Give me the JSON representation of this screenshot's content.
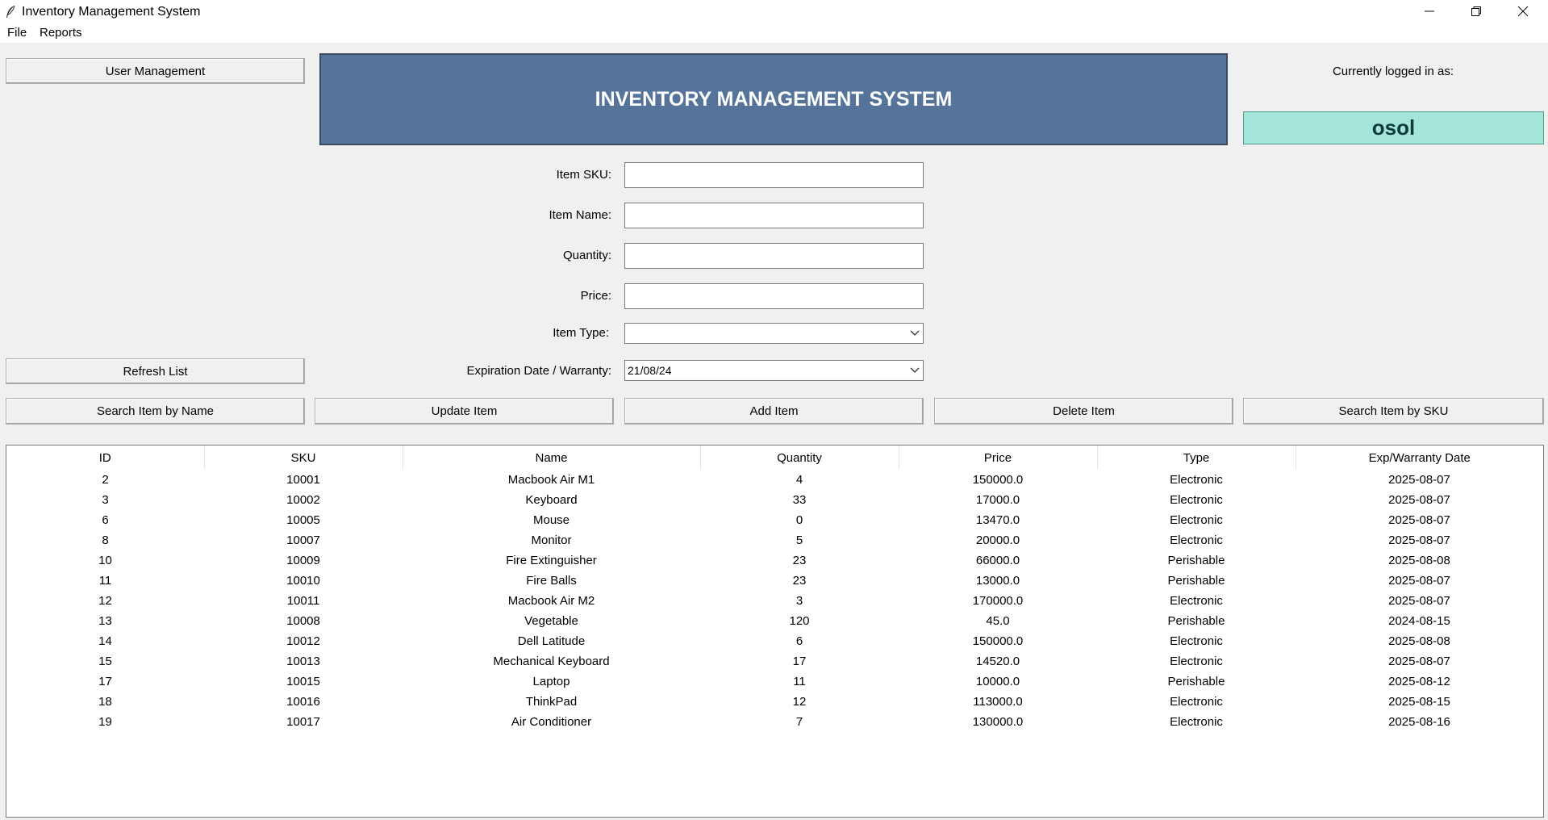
{
  "window": {
    "title": "Inventory Management System"
  },
  "menu": {
    "file": "File",
    "reports": "Reports"
  },
  "buttons": {
    "user_management": "User Management",
    "refresh_list": "Refresh List",
    "search_by_name": "Search Item by Name",
    "update_item": "Update Item",
    "add_item": "Add Item",
    "delete_item": "Delete Item",
    "search_by_sku": "Search Item by SKU"
  },
  "header": {
    "title": "INVENTORY MANAGEMENT SYSTEM"
  },
  "login": {
    "label": "Currently logged in as:",
    "user": "osol"
  },
  "form": {
    "sku_label": "Item SKU:",
    "name_label": "Item Name:",
    "quantity_label": "Quantity:",
    "price_label": "Price:",
    "type_label": "Item Type:",
    "type_value": "",
    "expiry_label": "Expiration Date / Warranty:",
    "expiry_value": "21/08/24"
  },
  "table": {
    "columns": [
      "ID",
      "SKU",
      "Name",
      "Quantity",
      "Price",
      "Type",
      "Exp/Warranty Date"
    ],
    "rows": [
      [
        "2",
        "10001",
        "Macbook Air M1",
        "4",
        "150000.0",
        "Electronic",
        "2025-08-07"
      ],
      [
        "3",
        "10002",
        "Keyboard",
        "33",
        "17000.0",
        "Electronic",
        "2025-08-07"
      ],
      [
        "6",
        "10005",
        "Mouse",
        "0",
        "13470.0",
        "Electronic",
        "2025-08-07"
      ],
      [
        "8",
        "10007",
        "Monitor",
        "5",
        "20000.0",
        "Electronic",
        "2025-08-07"
      ],
      [
        "10",
        "10009",
        "Fire Extinguisher",
        "23",
        "66000.0",
        "Perishable",
        "2025-08-08"
      ],
      [
        "11",
        "10010",
        "Fire Balls",
        "23",
        "13000.0",
        "Perishable",
        "2025-08-07"
      ],
      [
        "12",
        "10011",
        "Macbook Air M2",
        "3",
        "170000.0",
        "Electronic",
        "2025-08-07"
      ],
      [
        "13",
        "10008",
        "Vegetable",
        "120",
        "45.0",
        "Perishable",
        "2024-08-15"
      ],
      [
        "14",
        "10012",
        "Dell Latitude",
        "6",
        "150000.0",
        "Electronic",
        "2025-08-08"
      ],
      [
        "15",
        "10013",
        "Mechanical Keyboard",
        "17",
        "14520.0",
        "Electronic",
        "2025-08-07"
      ],
      [
        "17",
        "10015",
        "Laptop",
        "11",
        "10000.0",
        "Perishable",
        "2025-08-12"
      ],
      [
        "18",
        "10016",
        "ThinkPad",
        "12",
        "113000.0",
        "Electronic",
        "2025-08-15"
      ],
      [
        "19",
        "10017",
        "Air Conditioner",
        "7",
        "130000.0",
        "Electronic",
        "2025-08-16"
      ]
    ]
  },
  "colors": {
    "banner": "#56739a",
    "user_box": "#a3e6d9"
  }
}
